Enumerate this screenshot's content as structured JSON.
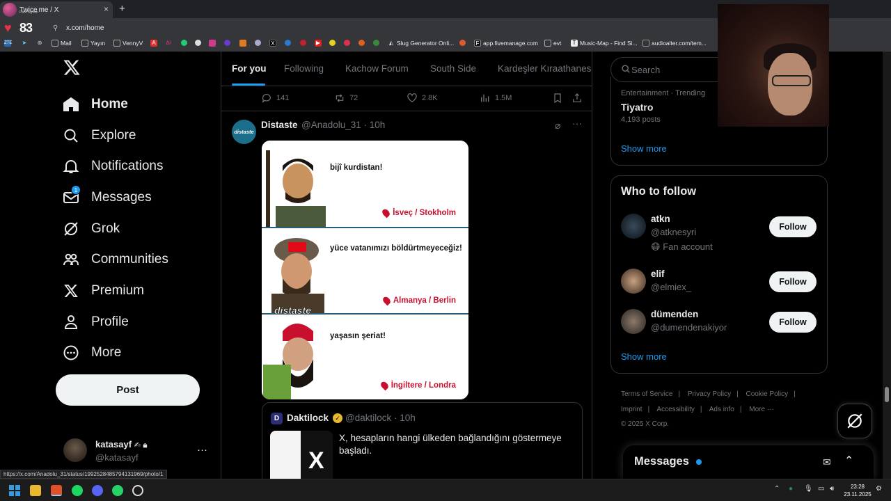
{
  "browser": {
    "tab_title": "Twice",
    "tab_title2": "me / X",
    "tab_subtitle": "Park Siyoon",
    "tab_close": "×",
    "new_tab": "+",
    "url": "x.com/home",
    "hud_number": "83",
    "bookmarks": [
      {
        "label": "Mail",
        "icon": "folder-icon"
      },
      {
        "label": "Yayın",
        "icon": "folder-icon"
      },
      {
        "label": "VennyV",
        "icon": "folder-icon"
      },
      {
        "label": "Slug Generator Onli...",
        "icon": "slug-icon"
      },
      {
        "label": "app.fivemanage.com",
        "icon": "fivem-icon"
      },
      {
        "label": "evt",
        "icon": "folder-icon"
      },
      {
        "label": "Music-Map - Find Si...",
        "icon": "music-icon"
      },
      {
        "label": "audioalter.com/tem...",
        "icon": "audio-icon"
      }
    ],
    "status_url": "https://x.com/Anadolu_31/status/1992528485794131969/photo/1"
  },
  "nav": {
    "items": [
      {
        "label": "Home",
        "icon": "home-icon"
      },
      {
        "label": "Explore",
        "icon": "search-icon"
      },
      {
        "label": "Notifications",
        "icon": "bell-icon"
      },
      {
        "label": "Messages",
        "icon": "envelope-icon",
        "badge": "1"
      },
      {
        "label": "Grok",
        "icon": "grok-icon"
      },
      {
        "label": "Communities",
        "icon": "people-icon"
      },
      {
        "label": "Premium",
        "icon": "x-logo-icon"
      },
      {
        "label": "Profile",
        "icon": "person-icon"
      },
      {
        "label": "More",
        "icon": "more-circle-icon"
      }
    ],
    "post_label": "Post",
    "account": {
      "name": "katasayf",
      "handle": "@katasayf",
      "more": "···"
    }
  },
  "feed": {
    "tabs": [
      "For you",
      "Following",
      "Kachow Forum",
      "South Side",
      "Kardeşler Kıraathanesi"
    ],
    "prev_actions": {
      "replies": "141",
      "reposts": "72",
      "likes": "2.8K",
      "views": "1.5M"
    },
    "tweet": {
      "avatar_text": "distaste",
      "name": "Distaste",
      "handle_time": "@Anadolu_31 · 10h",
      "meme": {
        "panels": [
          {
            "text": "bijî kurdistan!",
            "location": "İsveç / Stokholm"
          },
          {
            "text": "yüce vatanımızı böldürtmeyeceğiz!",
            "location": "Almanya / Berlin"
          },
          {
            "text": "yaşasın şeriat!",
            "location": "İngiltere / Londra"
          }
        ],
        "watermark": "distaste"
      },
      "quote": {
        "avatar_letter": "D",
        "name": "Daktilock",
        "handle_time": "@daktilock · 10h",
        "text": "X, hesapların hangi ülkeden bağlandığını göstermeye başladı."
      }
    }
  },
  "right": {
    "search_placeholder": "Search",
    "trend": {
      "meta": "Entertainment · Trending",
      "name": "Tiyatro",
      "count": "4,193 posts"
    },
    "show_more": "Show more",
    "who_to_follow": {
      "title": "Who to follow",
      "users": [
        {
          "name": "atkn",
          "handle": "@atknesyri",
          "extra": "Fan account",
          "follow": "Follow"
        },
        {
          "name": "elif",
          "handle": "@elmiex_",
          "extra": "",
          "follow": "Follow"
        },
        {
          "name": "dümenden",
          "handle": "@dumendenakiyor",
          "extra": "",
          "follow": "Follow"
        }
      ],
      "show_more": "Show more"
    },
    "footer": [
      "Terms of Service",
      "|",
      "Privacy Policy",
      "|",
      "Cookie Policy",
      "|",
      "Imprint",
      "|",
      "Accessibility",
      "|",
      "Ads info",
      "|",
      "More ···",
      "© 2025 X Corp."
    ],
    "messages_title": "Messages"
  },
  "taskbar": {
    "time": "23:28",
    "date": "23.11.2025"
  },
  "colors": {
    "accent": "#1d9bf0",
    "bg": "#000000",
    "muted": "#71767b",
    "location_red": "#c8102e"
  }
}
